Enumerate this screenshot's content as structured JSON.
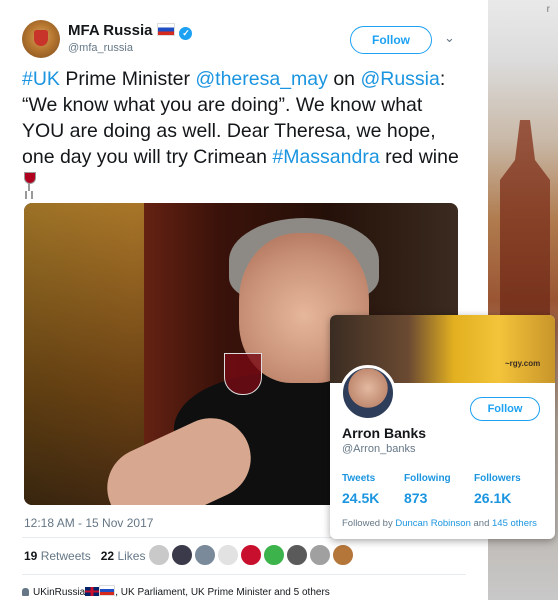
{
  "tweet": {
    "display_name": "MFA Russia",
    "handle": "@mfa_russia",
    "follow_label": "Follow",
    "text": {
      "p1": "#UK",
      "p2": " Prime Minister ",
      "p3": "@theresa_may",
      "p4": " on ",
      "p5": "@Russia",
      "p6": ": “We know what you are doing”. We know what YOU are doing as well. Dear Theresa, we hope, one day you will try Crimean ",
      "p7": "#Massandra",
      "p8": " red wine"
    },
    "timestamp": "12:18 AM - 15 Nov 2017",
    "retweets_count": "19",
    "retweets_label": "Retweets",
    "likes_count": "22",
    "likes_label": "Likes",
    "footer": {
      "prefix": "UKinRussia",
      "rest": ", UK Parliament, UK Prime Minister and 5 others"
    }
  },
  "hover_card": {
    "name": "Arron Banks",
    "handle": "@Arron_banks",
    "follow_label": "Follow",
    "banner_text": "~rgy.com",
    "stats": [
      {
        "label": "Tweets",
        "value": "24.5K"
      },
      {
        "label": "Following",
        "value": "873"
      },
      {
        "label": "Followers",
        "value": "26.1K"
      }
    ],
    "followed_prefix": "Followed by ",
    "followed_name": "Duncan Robinson",
    "followed_and": " and ",
    "followed_others": "145 others"
  },
  "right_panel": {
    "mark": "r"
  },
  "colors": {
    "link": "#1b95e0",
    "accent": "#1da1f2",
    "muted": "#657786"
  },
  "icons": [
    "verified-icon",
    "russia-flag-icon",
    "chevron-down-icon",
    "wine-glass-icon",
    "person-icon",
    "uk-flag-icon"
  ]
}
